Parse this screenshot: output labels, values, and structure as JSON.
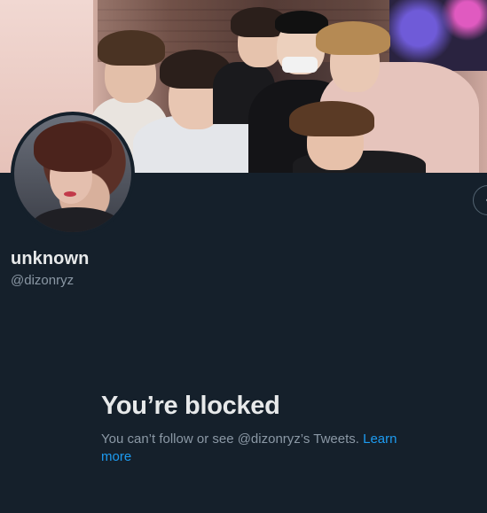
{
  "profile": {
    "display_name": "unknown",
    "handle": "@dizonryz"
  },
  "blocked": {
    "title": "You’re blocked",
    "message": "You can’t follow or see @dizonryz’s Tweets.",
    "link_label": "Learn more"
  },
  "icons": {
    "more": "more-options-icon"
  },
  "colors": {
    "background": "#15202b",
    "primary_text": "#e7e9ea",
    "secondary_text": "#8b98a5",
    "link": "#1d9bf0"
  }
}
